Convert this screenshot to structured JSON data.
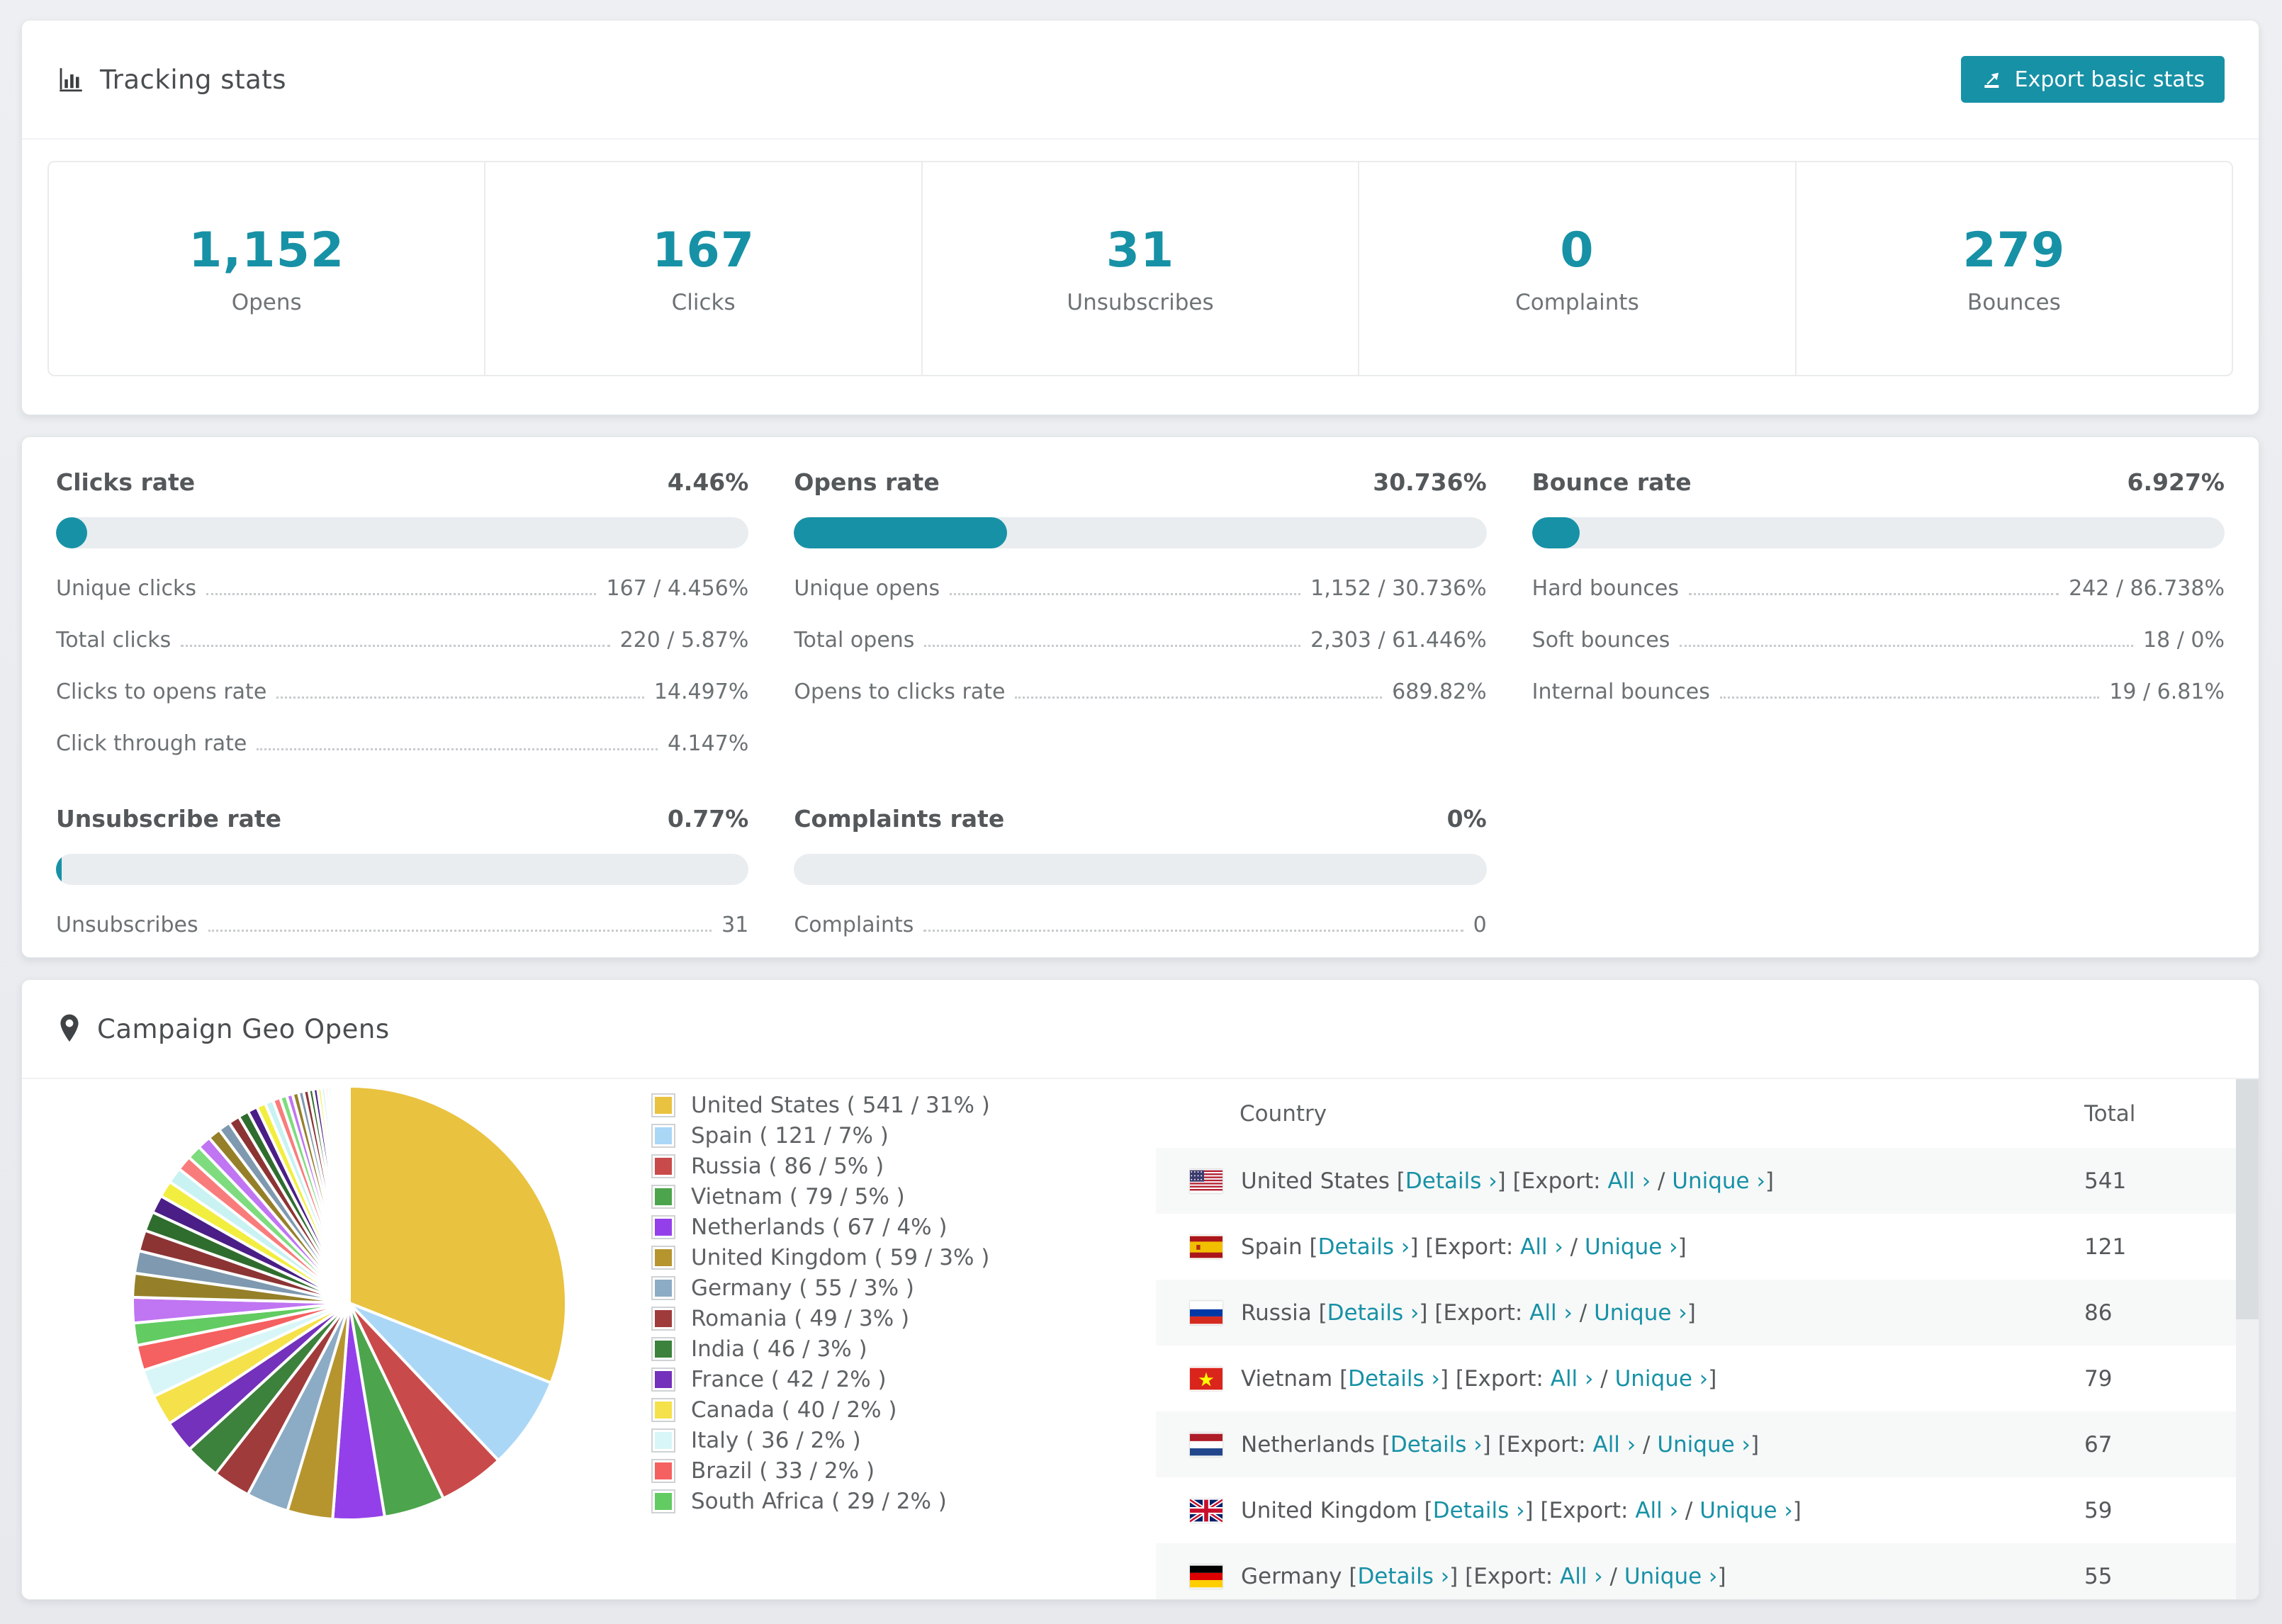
{
  "tracking": {
    "title": "Tracking stats",
    "export_button": "Export basic stats",
    "stats": [
      {
        "value": "1,152",
        "label": "Opens"
      },
      {
        "value": "167",
        "label": "Clicks"
      },
      {
        "value": "31",
        "label": "Unsubscribes"
      },
      {
        "value": "0",
        "label": "Complaints"
      },
      {
        "value": "279",
        "label": "Bounces"
      }
    ]
  },
  "rates": {
    "sections": [
      {
        "id": "clicks-rate",
        "title": "Clicks rate",
        "value": "4.46%",
        "bar_pct": 4.46,
        "rows": [
          {
            "label": "Unique clicks",
            "value": "167 / 4.456%"
          },
          {
            "label": "Total clicks",
            "value": "220 / 5.87%"
          },
          {
            "label": "Clicks to opens rate",
            "value": "14.497%"
          },
          {
            "label": "Click through rate",
            "value": "4.147%"
          }
        ]
      },
      {
        "id": "opens-rate",
        "title": "Opens rate",
        "value": "30.736%",
        "bar_pct": 30.736,
        "rows": [
          {
            "label": "Unique opens",
            "value": "1,152 / 30.736%"
          },
          {
            "label": "Total opens",
            "value": "2,303 / 61.446%"
          },
          {
            "label": "Opens to clicks rate",
            "value": "689.82%"
          }
        ]
      },
      {
        "id": "bounce-rate",
        "title": "Bounce rate",
        "value": "6.927%",
        "bar_pct": 6.927,
        "rows": [
          {
            "label": "Hard bounces",
            "value": "242 / 86.738%"
          },
          {
            "label": "Soft bounces",
            "value": "18 / 0%"
          },
          {
            "label": "Internal bounces",
            "value": "19 / 6.81%"
          }
        ]
      },
      {
        "id": "unsubscribe-rate",
        "title": "Unsubscribe rate",
        "value": "0.77%",
        "bar_pct": 0.77,
        "rows": [
          {
            "label": "Unsubscribes",
            "value": "31"
          }
        ]
      },
      {
        "id": "complaints-rate",
        "title": "Complaints rate",
        "value": "0%",
        "bar_pct": 0,
        "rows": [
          {
            "label": "Complaints",
            "value": "0"
          }
        ]
      }
    ]
  },
  "geo": {
    "title": "Campaign Geo Opens",
    "table": {
      "headers": {
        "country": "Country",
        "total": "Total"
      },
      "link_parts": {
        "open_bracket": "[",
        "close_bracket": "]",
        "details": "Details ›",
        "export_prefix": "[Export:",
        "all": "All ›",
        "slash": "/",
        "unique": "Unique ›"
      },
      "rows": [
        {
          "country": "United States",
          "flag": "us",
          "total": "541"
        },
        {
          "country": "Spain",
          "flag": "es",
          "total": "121"
        },
        {
          "country": "Russia",
          "flag": "ru",
          "total": "86"
        },
        {
          "country": "Vietnam",
          "flag": "vn",
          "total": "79"
        },
        {
          "country": "Netherlands",
          "flag": "nl",
          "total": "67"
        },
        {
          "country": "United Kingdom",
          "flag": "gb",
          "total": "59"
        },
        {
          "country": "Germany",
          "flag": "de",
          "total": "55"
        }
      ]
    }
  },
  "chart_data": {
    "type": "pie",
    "title": "Campaign Geo Opens",
    "legend_position": "right",
    "total": 1745,
    "slices": [
      {
        "label": "United States",
        "value": 541,
        "pct": 31,
        "color": "#e9c23f",
        "legend": "United States ( 541 / 31% )"
      },
      {
        "label": "Spain",
        "value": 121,
        "pct": 7,
        "color": "#abd7f7",
        "legend": "Spain ( 121 / 7% )"
      },
      {
        "label": "Russia",
        "value": 86,
        "pct": 5,
        "color": "#c94a4a",
        "legend": "Russia ( 86 / 5% )"
      },
      {
        "label": "Vietnam",
        "value": 79,
        "pct": 5,
        "color": "#4ca54c",
        "legend": "Vietnam ( 79 / 5% )"
      },
      {
        "label": "Netherlands",
        "value": 67,
        "pct": 4,
        "color": "#9340ea",
        "legend": "Netherlands ( 67 / 4% )"
      },
      {
        "label": "United Kingdom",
        "value": 59,
        "pct": 3,
        "color": "#b6952f",
        "legend": "United Kingdom ( 59 / 3% )"
      },
      {
        "label": "Germany",
        "value": 55,
        "pct": 3,
        "color": "#8cabc5",
        "legend": "Germany ( 55 / 3% )"
      },
      {
        "label": "Romania",
        "value": 49,
        "pct": 3,
        "color": "#a03b3b",
        "legend": "Romania ( 49 / 3% )"
      },
      {
        "label": "India",
        "value": 46,
        "pct": 3,
        "color": "#3c813c",
        "legend": "India ( 46 / 3% )"
      },
      {
        "label": "France",
        "value": 42,
        "pct": 2,
        "color": "#7431bb",
        "legend": "France ( 42 / 2% )"
      },
      {
        "label": "Canada",
        "value": 40,
        "pct": 2,
        "color": "#f5e14a",
        "legend": "Canada ( 40 / 2% )"
      },
      {
        "label": "Italy",
        "value": 36,
        "pct": 2,
        "color": "#d8f6f7",
        "legend": "Italy ( 36 / 2% )"
      },
      {
        "label": "Brazil",
        "value": 33,
        "pct": 2,
        "color": "#f56060",
        "legend": "Brazil ( 33 / 2% )"
      },
      {
        "label": "South Africa",
        "value": 29,
        "pct": 2,
        "color": "#62cb62",
        "legend": "South Africa ( 29 / 2% )"
      }
    ],
    "others": {
      "total_value": 462,
      "note": "many small unlabeled country slices",
      "weights": [
        34,
        32,
        30,
        28,
        26,
        24,
        22,
        21,
        20,
        19,
        18,
        17,
        16,
        15,
        14,
        13,
        12,
        11,
        10,
        9,
        8,
        8,
        7,
        7,
        6,
        6,
        5,
        5,
        4,
        4,
        3,
        3,
        3,
        2,
        2,
        2,
        2,
        1,
        1,
        1,
        1,
        1,
        1,
        1
      ],
      "palette": [
        "#c075f2",
        "#958029",
        "#7e99b0",
        "#8c3434",
        "#2f6d2f",
        "#4a1e86",
        "#f2ee3f",
        "#c9f2f2",
        "#f97c7c",
        "#7edc7e"
      ]
    }
  }
}
